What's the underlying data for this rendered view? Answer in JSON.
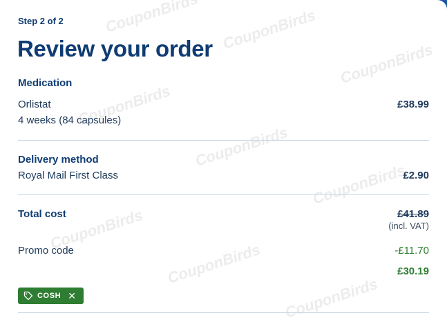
{
  "step_label": "Step 2 of 2",
  "title": "Review your order",
  "medication": {
    "heading": "Medication",
    "name": "Orlistat",
    "detail": "4 weeks (84 capsules)",
    "price": "£38.99"
  },
  "delivery": {
    "heading": "Delivery method",
    "name": "Royal Mail First Class",
    "price": "£2.90"
  },
  "total": {
    "label": "Total cost",
    "original_price": "£41.89",
    "vat_note": "(incl. VAT)",
    "promo_label": "Promo code",
    "discount": "-£11.70",
    "final_price": "£30.19"
  },
  "promo_tag": {
    "code": "COSH",
    "icon": "tag-icon",
    "remove_icon": "close-icon"
  },
  "watermark": "CouponBirds",
  "colors": {
    "heading": "#0f3c73",
    "accent_green": "#2e7d32",
    "divider": "#c9d8e6"
  }
}
